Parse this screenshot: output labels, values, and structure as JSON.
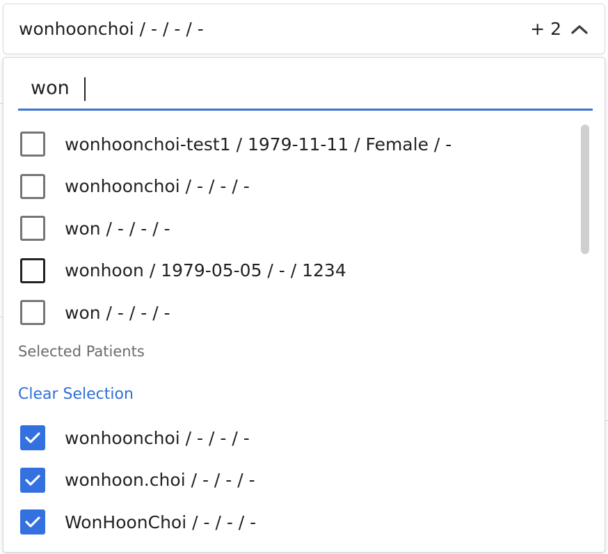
{
  "select": {
    "value": "wonhoonchoi / - / - / -",
    "more_count": "+ 2",
    "chevron_icon": "chevron-up-icon"
  },
  "search": {
    "value": "won",
    "placeholder": ""
  },
  "results": [
    {
      "label": "wonhoonchoi-test1 / 1979-11-11 / Female / -",
      "checked": false
    },
    {
      "label": "wonhoonchoi / - / - / -",
      "checked": false
    },
    {
      "label": "won / - / - / -",
      "checked": false
    },
    {
      "label": "wonhoon / 1979-05-05 / - / 1234",
      "checked": false
    },
    {
      "label": "won / - / - / -",
      "checked": false
    }
  ],
  "selected_section": {
    "title": "Selected Patients",
    "clear_label": "Clear Selection",
    "items": [
      {
        "label": "wonhoonchoi / - / - / -",
        "checked": true
      },
      {
        "label": "wonhoon.choi / - / - / -",
        "checked": true
      },
      {
        "label": "WonHoonChoi / - / - / -",
        "checked": true
      }
    ]
  },
  "colors": {
    "accent": "#3370e0",
    "link": "#2f6fd6",
    "search_underline": "#3a74d8"
  }
}
